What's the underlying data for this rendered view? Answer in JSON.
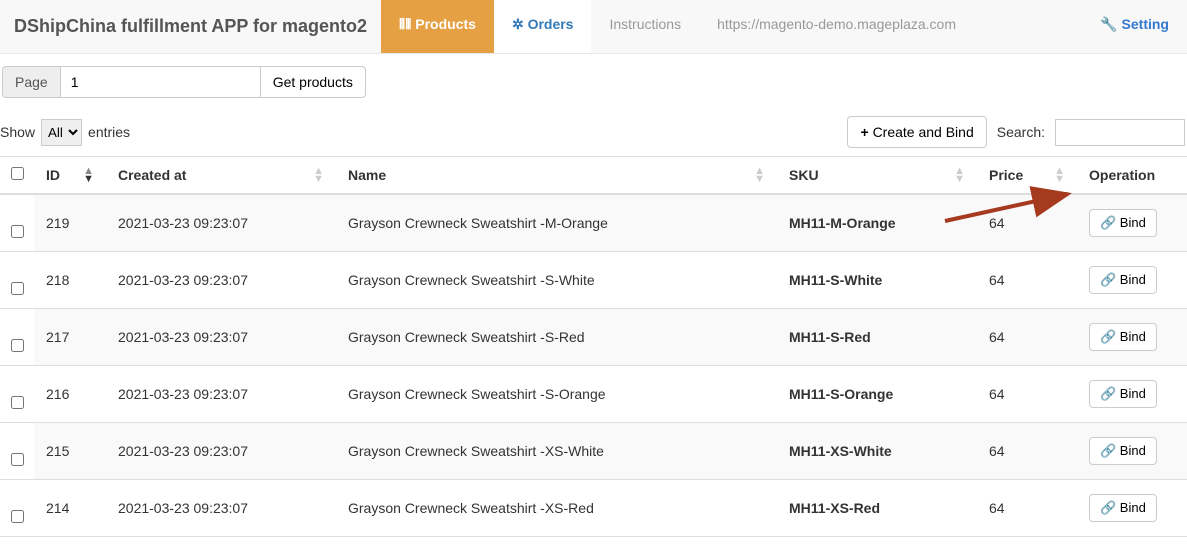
{
  "header": {
    "brand": "DShipChina fulfillment APP for magento2",
    "nav": {
      "products": "Products",
      "orders": "Orders",
      "instructions": "Instructions",
      "url": "https://magento-demo.mageplaza.com",
      "setting": "Setting"
    }
  },
  "toolbar": {
    "page_label": "Page",
    "page_value": "1",
    "get_products": "Get products"
  },
  "controls": {
    "show_label": "Show",
    "entries_label": "entries",
    "length_option": "All",
    "create_bind": "Create and Bind",
    "search_label": "Search:"
  },
  "table": {
    "headers": {
      "id": "ID",
      "created": "Created at",
      "name": "Name",
      "sku": "SKU",
      "price": "Price",
      "operation": "Operation"
    },
    "bind_label": "Bind",
    "rows": [
      {
        "id": "219",
        "created": "2021-03-23 09:23:07",
        "name": "Grayson Crewneck Sweatshirt -M-Orange",
        "sku": "MH11-M-Orange",
        "price": "64"
      },
      {
        "id": "218",
        "created": "2021-03-23 09:23:07",
        "name": "Grayson Crewneck Sweatshirt -S-White",
        "sku": "MH11-S-White",
        "price": "64"
      },
      {
        "id": "217",
        "created": "2021-03-23 09:23:07",
        "name": "Grayson Crewneck Sweatshirt -S-Red",
        "sku": "MH11-S-Red",
        "price": "64"
      },
      {
        "id": "216",
        "created": "2021-03-23 09:23:07",
        "name": "Grayson Crewneck Sweatshirt -S-Orange",
        "sku": "MH11-S-Orange",
        "price": "64"
      },
      {
        "id": "215",
        "created": "2021-03-23 09:23:07",
        "name": "Grayson Crewneck Sweatshirt -XS-White",
        "sku": "MH11-XS-White",
        "price": "64"
      },
      {
        "id": "214",
        "created": "2021-03-23 09:23:07",
        "name": "Grayson Crewneck Sweatshirt -XS-Red",
        "sku": "MH11-XS-Red",
        "price": "64"
      }
    ]
  }
}
